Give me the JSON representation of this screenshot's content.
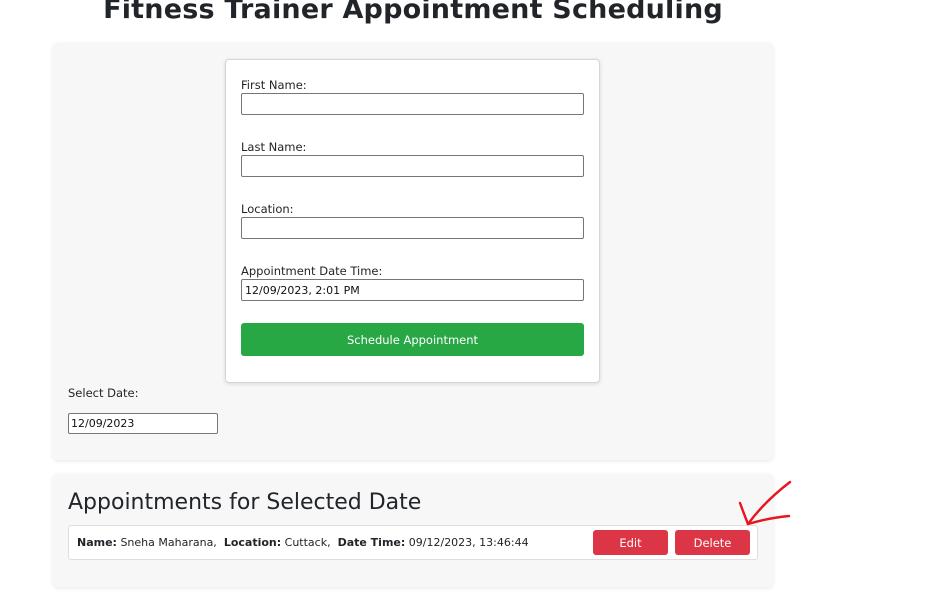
{
  "page": {
    "title": "Fitness Trainer Appointment Scheduling"
  },
  "form": {
    "first_name_label": "First Name:",
    "first_name_value": "",
    "last_name_label": "Last Name:",
    "last_name_value": "",
    "location_label": "Location:",
    "location_value": "",
    "datetime_label": "Appointment Date Time:",
    "datetime_value": "12/09/2023, 2:01 PM",
    "submit_label": "Schedule Appointment"
  },
  "date_filter": {
    "label": "Select Date:",
    "value": "12/09/2023"
  },
  "appointments": {
    "heading": "Appointments for Selected Date",
    "items": [
      {
        "name_label": "Name:",
        "name": "Sneha Maharana,",
        "location_label": "Location:",
        "location": "Cuttack,",
        "datetime_label": "Date Time:",
        "datetime": "09/12/2023, 13:46:44",
        "edit_label": "Edit",
        "delete_label": "Delete"
      }
    ]
  },
  "colors": {
    "primary_action": "#28a745",
    "danger": "#dc3545",
    "annotation": "#e8141e"
  },
  "annotation": {
    "icon": "checkmark-arrow-annotation"
  }
}
